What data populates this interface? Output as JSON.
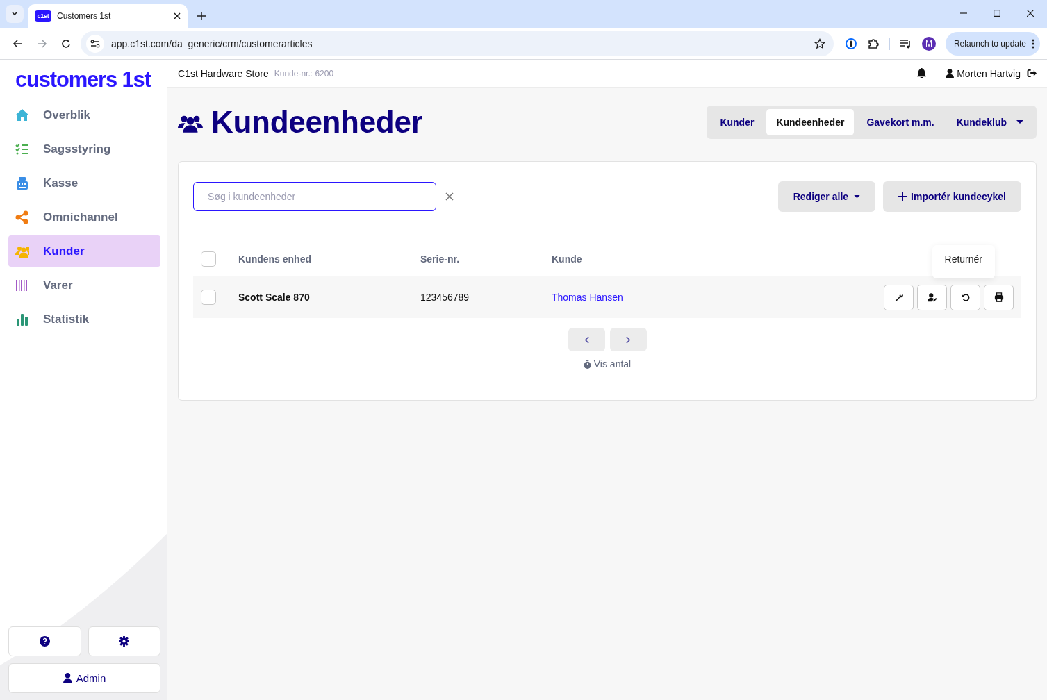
{
  "browser": {
    "tab_title": "Customers 1st",
    "favicon_text": "c1st",
    "url": "app.c1st.com/da_generic/crm/customerarticles",
    "profile_initial": "M",
    "update_button": "Relaunch to update"
  },
  "sidebar": {
    "logo": "customers 1st",
    "items": [
      {
        "label": "Overblik",
        "selected": false
      },
      {
        "label": "Sagsstyring",
        "selected": false
      },
      {
        "label": "Kasse",
        "selected": false
      },
      {
        "label": "Omnichannel",
        "selected": false
      },
      {
        "label": "Kunder",
        "selected": true
      },
      {
        "label": "Varer",
        "selected": false
      },
      {
        "label": "Statistik",
        "selected": false
      }
    ],
    "admin_button": "Admin"
  },
  "header": {
    "store": "C1st Hardware Store",
    "customer_no": "Kunde-nr.: 6200",
    "user": "Morten Hartvig"
  },
  "page": {
    "title": "Kundeenheder",
    "tabs": [
      {
        "label": "Kunder",
        "selected": false
      },
      {
        "label": "Kundeenheder",
        "selected": true
      },
      {
        "label": "Gavekort m.m.",
        "selected": false
      },
      {
        "label": "Kundeklub",
        "selected": false
      }
    ],
    "search": {
      "placeholder": "Søg i kundeenheder"
    },
    "edit_all_button": "Rediger alle",
    "import_button": "Importér kundecykel",
    "table": {
      "columns": [
        "Kundens enhed",
        "Serie-nr.",
        "Kunde"
      ],
      "header_checked": false,
      "rows": [
        {
          "checked": false,
          "unit": "Scott Scale 870",
          "serial": "123456789",
          "customer": "Thomas Hansen"
        }
      ]
    },
    "tooltip": "Returnér",
    "show_count": "Vis antal"
  }
}
